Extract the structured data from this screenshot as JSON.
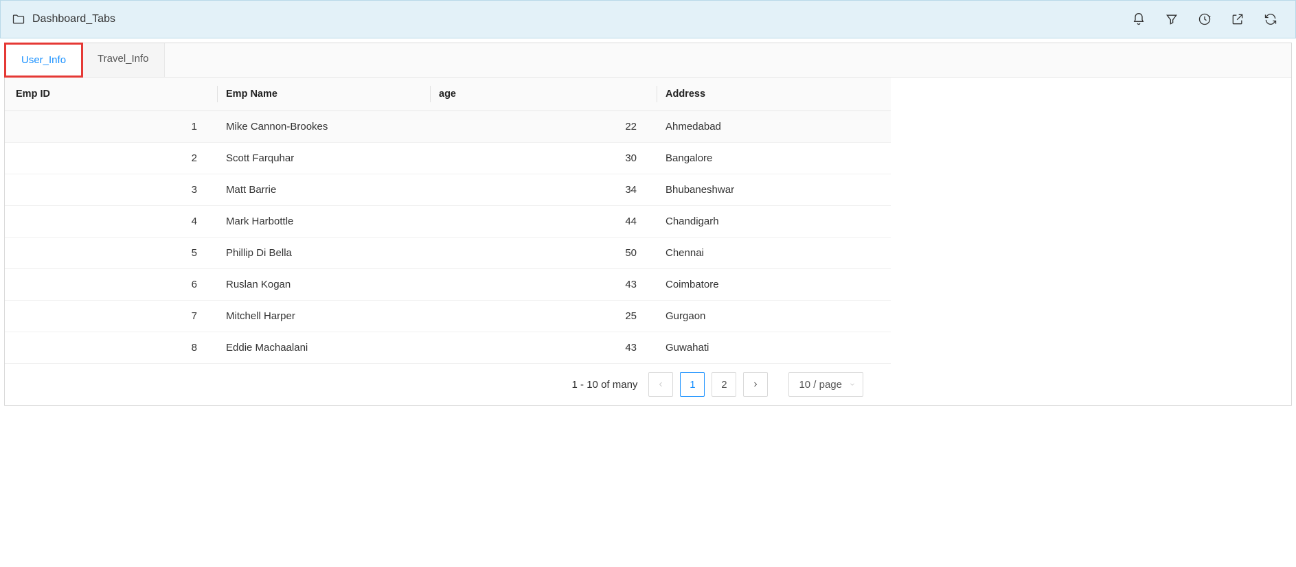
{
  "header": {
    "title": "Dashboard_Tabs"
  },
  "tabs": [
    {
      "label": "User_Info",
      "active": true
    },
    {
      "label": "Travel_Info",
      "active": false
    }
  ],
  "table": {
    "columns": [
      "Emp ID",
      "Emp Name",
      "age",
      "Address"
    ],
    "rows": [
      {
        "id": "1",
        "name": "Mike Cannon-Brookes",
        "age": "22",
        "address": "Ahmedabad"
      },
      {
        "id": "2",
        "name": "Scott Farquhar",
        "age": "30",
        "address": "Bangalore"
      },
      {
        "id": "3",
        "name": "Matt Barrie",
        "age": "34",
        "address": "Bhubaneshwar"
      },
      {
        "id": "4",
        "name": "Mark Harbottle",
        "age": "44",
        "address": "Chandigarh"
      },
      {
        "id": "5",
        "name": "Phillip Di Bella",
        "age": "50",
        "address": "Chennai"
      },
      {
        "id": "6",
        "name": "Ruslan Kogan",
        "age": "43",
        "address": "Coimbatore"
      },
      {
        "id": "7",
        "name": "Mitchell Harper",
        "age": "25",
        "address": "Gurgaon"
      },
      {
        "id": "8",
        "name": "Eddie Machaalani",
        "age": "43",
        "address": "Guwahati"
      }
    ]
  },
  "pagination": {
    "info": "1 - 10 of many",
    "pages": [
      "1",
      "2"
    ],
    "active_page": "1",
    "page_size": "10 / page"
  }
}
